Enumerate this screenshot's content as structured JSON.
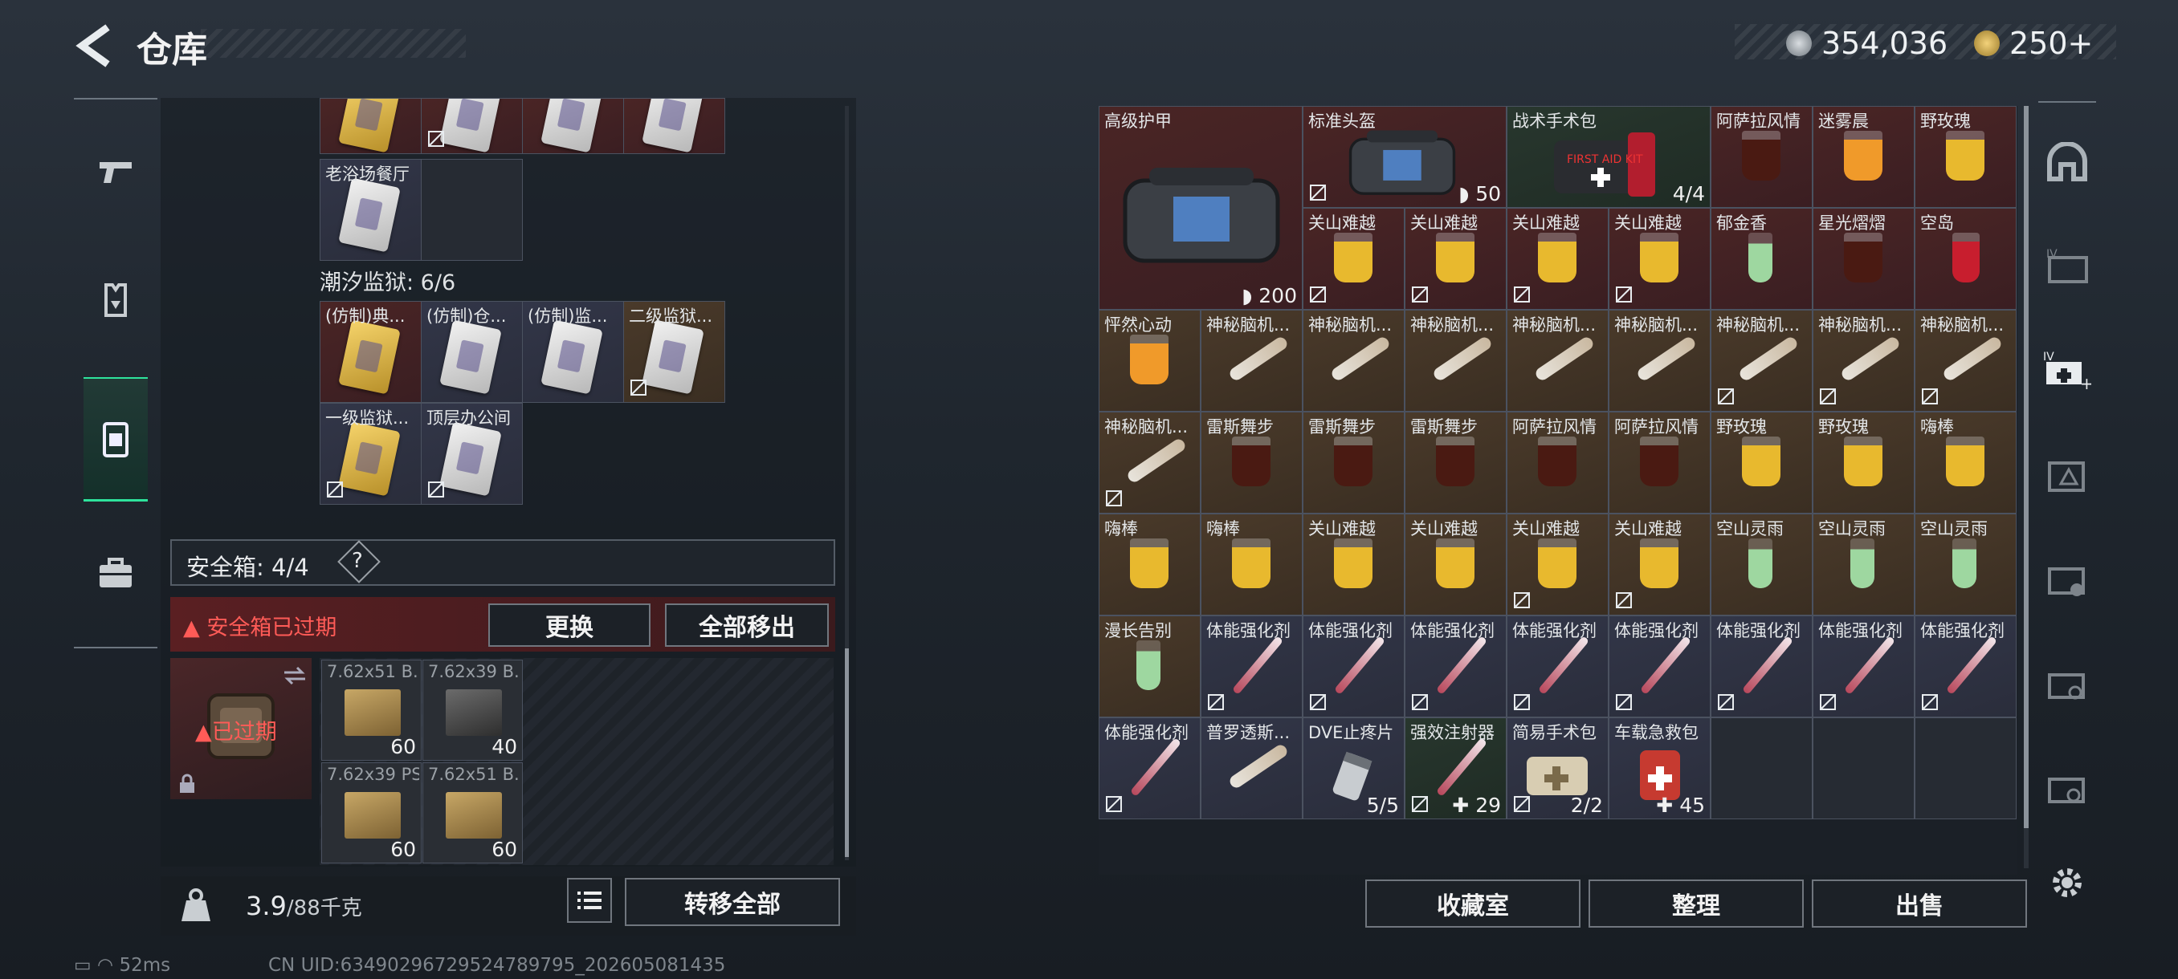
{
  "header": {
    "title": "仓库",
    "currency1": "354,036",
    "currency2": "250+"
  },
  "left_grid_top": [
    {
      "label": "",
      "bg": "red",
      "card": "gold",
      "locked": false
    },
    {
      "label": "",
      "bg": "red",
      "card": "white",
      "locked": true
    },
    {
      "label": "",
      "bg": "red",
      "card": "white",
      "locked": false
    },
    {
      "label": "",
      "bg": "red",
      "card": "white",
      "locked": false
    },
    {
      "label": "老浴场餐厅",
      "bg": "blue",
      "card": "white",
      "locked": false
    }
  ],
  "tide": {
    "label": "潮汐监狱: 6/6"
  },
  "tide_cards": [
    {
      "label": "(仿制)典...",
      "bg": "red",
      "card": "gold",
      "locked": false
    },
    {
      "label": "(仿制)仓...",
      "bg": "blue",
      "card": "white",
      "locked": false
    },
    {
      "label": "(仿制)监...",
      "bg": "blue",
      "card": "white",
      "locked": false
    },
    {
      "label": "二级监狱...",
      "bg": "gold",
      "card": "white",
      "locked": true
    },
    {
      "label": "一级监狱...",
      "bg": "blue",
      "card": "gold",
      "locked": true
    },
    {
      "label": "顶层办公间",
      "bg": "blue",
      "card": "white",
      "locked": true
    }
  ],
  "safebox": {
    "label": "安全箱: 4/4",
    "help": "?",
    "expired_notice": "安全箱已过期",
    "replace_btn": "更换",
    "move_all_btn": "全部移出",
    "case_status": "已过期"
  },
  "ammo": [
    {
      "label": "7.62x51 B...",
      "count": "60",
      "dark": false
    },
    {
      "label": "7.62x39 B...",
      "count": "40",
      "dark": true
    },
    {
      "label": "7.62x39 PS",
      "count": "60",
      "dark": false
    },
    {
      "label": "7.62x51 B...",
      "count": "60",
      "dark": false
    }
  ],
  "weight": {
    "current": "3.9",
    "max": "/88千克"
  },
  "left_bottom": {
    "transfer_all_btn": "转移全部"
  },
  "status": {
    "ping": "52ms",
    "uid": "CN UID:63490296729524789795_202605081435"
  },
  "right_items": [
    {
      "label": "高级护甲",
      "count": "200",
      "bg": "red",
      "kind": "bag",
      "shield": true,
      "locked": false,
      "big": true
    },
    {
      "label": "标准头盔",
      "count": "50",
      "bg": "red",
      "kind": "bag",
      "shield": true,
      "locked": true,
      "wide": true
    },
    {
      "label": "战术手术包",
      "count": "4/4",
      "bg": "green",
      "kind": "medkit",
      "locked": false,
      "wide": true
    },
    {
      "label": "阿萨拉风情",
      "count": "",
      "bg": "red",
      "kind": "dark",
      "locked": false
    },
    {
      "label": "迷雾晨",
      "count": "",
      "bg": "red",
      "kind": "orange",
      "locked": false
    },
    {
      "label": "野玫瑰",
      "count": "",
      "bg": "red",
      "kind": "yellow",
      "locked": false
    },
    {
      "label": "关山难越",
      "count": "",
      "bg": "red",
      "kind": "yellow",
      "locked": true
    },
    {
      "label": "关山难越",
      "count": "",
      "bg": "red",
      "kind": "yellow",
      "locked": true
    },
    {
      "label": "关山难越",
      "count": "",
      "bg": "red",
      "kind": "yellow",
      "locked": true
    },
    {
      "label": "关山难越",
      "count": "",
      "bg": "red",
      "kind": "yellow",
      "locked": true
    },
    {
      "label": "郁金香",
      "count": "",
      "bg": "red",
      "kind": "green",
      "locked": false
    },
    {
      "label": "星光熠熠",
      "count": "",
      "bg": "red",
      "kind": "dark",
      "locked": false
    },
    {
      "label": "空岛",
      "count": "",
      "bg": "red",
      "kind": "red",
      "locked": false
    },
    {
      "label": "怦然心动",
      "count": "",
      "bg": "gold",
      "kind": "orange",
      "locked": false
    },
    {
      "label": "神秘脑机...",
      "count": "",
      "bg": "gold",
      "kind": "tube",
      "locked": false
    },
    {
      "label": "神秘脑机...",
      "count": "",
      "bg": "gold",
      "kind": "tube",
      "locked": false
    },
    {
      "label": "神秘脑机...",
      "count": "",
      "bg": "gold",
      "kind": "tube",
      "locked": false
    },
    {
      "label": "神秘脑机...",
      "count": "",
      "bg": "gold",
      "kind": "tube",
      "locked": false
    },
    {
      "label": "神秘脑机...",
      "count": "",
      "bg": "gold",
      "kind": "tube",
      "locked": false
    },
    {
      "label": "神秘脑机...",
      "count": "",
      "bg": "gold",
      "kind": "tube",
      "locked": true
    },
    {
      "label": "神秘脑机...",
      "count": "",
      "bg": "gold",
      "kind": "tube",
      "locked": true
    },
    {
      "label": "神秘脑机...",
      "count": "",
      "bg": "gold",
      "kind": "tube",
      "locked": true
    },
    {
      "label": "神秘脑机...",
      "count": "",
      "bg": "gold",
      "kind": "tube",
      "locked": true
    },
    {
      "label": "雷斯舞步",
      "count": "",
      "bg": "gold",
      "kind": "dark",
      "locked": false
    },
    {
      "label": "雷斯舞步",
      "count": "",
      "bg": "gold",
      "kind": "dark",
      "locked": false
    },
    {
      "label": "雷斯舞步",
      "count": "",
      "bg": "gold",
      "kind": "dark",
      "locked": false
    },
    {
      "label": "阿萨拉风情",
      "count": "",
      "bg": "gold",
      "kind": "dark",
      "locked": false
    },
    {
      "label": "阿萨拉风情",
      "count": "",
      "bg": "gold",
      "kind": "dark",
      "locked": false
    },
    {
      "label": "野玫瑰",
      "count": "",
      "bg": "gold",
      "kind": "yellow",
      "locked": false
    },
    {
      "label": "野玫瑰",
      "count": "",
      "bg": "gold",
      "kind": "yellow",
      "locked": false
    },
    {
      "label": "嗨棒",
      "count": "",
      "bg": "gold",
      "kind": "yellow",
      "locked": false
    },
    {
      "label": "嗨棒",
      "count": "",
      "bg": "gold",
      "kind": "yellow",
      "locked": false
    },
    {
      "label": "嗨棒",
      "count": "",
      "bg": "gold",
      "kind": "yellow",
      "locked": false
    },
    {
      "label": "关山难越",
      "count": "",
      "bg": "gold",
      "kind": "yellow",
      "locked": false
    },
    {
      "label": "关山难越",
      "count": "",
      "bg": "gold",
      "kind": "yellow",
      "locked": false
    },
    {
      "label": "关山难越",
      "count": "",
      "bg": "gold",
      "kind": "yellow",
      "locked": true
    },
    {
      "label": "关山难越",
      "count": "",
      "bg": "gold",
      "kind": "yellow",
      "locked": true
    },
    {
      "label": "空山灵雨",
      "count": "",
      "bg": "gold",
      "kind": "green",
      "locked": false
    },
    {
      "label": "空山灵雨",
      "count": "",
      "bg": "gold",
      "kind": "green",
      "locked": false
    },
    {
      "label": "空山灵雨",
      "count": "",
      "bg": "gold",
      "kind": "green",
      "locked": false
    },
    {
      "label": "漫长告别",
      "count": "",
      "bg": "gold",
      "kind": "green",
      "locked": false
    },
    {
      "label": "体能强化剂",
      "count": "",
      "bg": "blue",
      "kind": "syringe",
      "locked": true
    },
    {
      "label": "体能强化剂",
      "count": "",
      "bg": "blue",
      "kind": "syringe",
      "locked": true
    },
    {
      "label": "体能强化剂",
      "count": "",
      "bg": "blue",
      "kind": "syringe",
      "locked": true
    },
    {
      "label": "体能强化剂",
      "count": "",
      "bg": "blue",
      "kind": "syringe",
      "locked": true
    },
    {
      "label": "体能强化剂",
      "count": "",
      "bg": "blue",
      "kind": "syringe",
      "locked": true
    },
    {
      "label": "体能强化剂",
      "count": "",
      "bg": "blue",
      "kind": "syringe",
      "locked": true
    },
    {
      "label": "体能强化剂",
      "count": "",
      "bg": "blue",
      "kind": "syringe",
      "locked": true
    },
    {
      "label": "体能强化剂",
      "count": "",
      "bg": "blue",
      "kind": "syringe",
      "locked": true
    },
    {
      "label": "体能强化剂",
      "count": "",
      "bg": "blue",
      "kind": "syringe",
      "locked": true
    },
    {
      "label": "普罗透斯...",
      "count": "",
      "bg": "blue",
      "kind": "tube",
      "locked": false
    },
    {
      "label": "DVE止疼片",
      "count": "5/5",
      "bg": "blue",
      "kind": "pills",
      "locked": false
    },
    {
      "label": "强效注射器",
      "count": "29",
      "bg": "green",
      "kind": "syringe",
      "locked": true,
      "plus": true
    },
    {
      "label": "简易手术包",
      "count": "2/2",
      "bg": "blue",
      "kind": "pouch",
      "locked": true
    },
    {
      "label": "车载急救包",
      "count": "45",
      "bg": "blue",
      "kind": "redbag",
      "locked": false,
      "plus": true
    }
  ],
  "right_bottom": {
    "collection_btn": "收藏室",
    "sort_btn": "整理",
    "sell_btn": "出售"
  }
}
